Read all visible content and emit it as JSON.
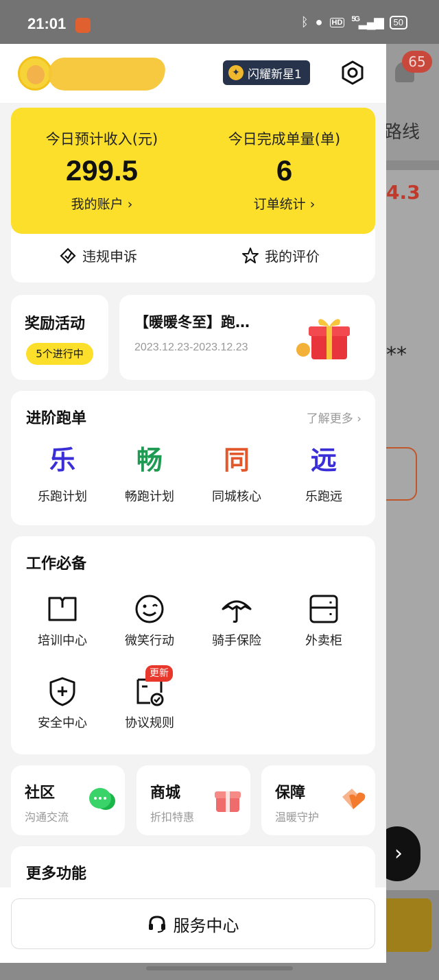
{
  "status_bar": {
    "time": "21:01",
    "network": "5G",
    "battery": "50",
    "hd": "HD"
  },
  "header": {
    "level_badge": "闪耀新星1"
  },
  "income_card": {
    "income_label": "今日预计收入(元)",
    "income_value": "299.5",
    "account_link": "我的账户 ›",
    "orders_label": "今日完成单量(单)",
    "orders_value": "6",
    "stats_link": "订单统计 ›",
    "appeal": "违规申诉",
    "rating": "我的评价"
  },
  "reward": {
    "title": "奖励活动",
    "count": "5个进行中"
  },
  "promo": {
    "title": "【暖暖冬至】跑…",
    "dates": "2023.12.23-2023.12.23"
  },
  "advanced": {
    "title": "进阶跑单",
    "more": "了解更多 ›",
    "items": [
      {
        "char": "乐",
        "label": "乐跑计划",
        "color": "#3a2fd6"
      },
      {
        "char": "畅",
        "label": "畅跑计划",
        "color": "#1e9a52"
      },
      {
        "char": "同",
        "label": "同城核心",
        "color": "#e3572c"
      },
      {
        "char": "远",
        "label": "乐跑远",
        "color": "#3a2fd6"
      }
    ]
  },
  "work": {
    "title": "工作必备",
    "items": [
      {
        "label": "培训中心",
        "icon": "book-icon"
      },
      {
        "label": "微笑行动",
        "icon": "smile-icon"
      },
      {
        "label": "骑手保险",
        "icon": "umbrella-icon"
      },
      {
        "label": "外卖柜",
        "icon": "locker-icon"
      },
      {
        "label": "安全中心",
        "icon": "shield-icon"
      },
      {
        "label": "协议规则",
        "icon": "agreement-icon"
      }
    ],
    "new_badge": "更新"
  },
  "mini_cards": [
    {
      "title": "社区",
      "sub": "沟通交流",
      "icon": "chat-icon"
    },
    {
      "title": "商城",
      "sub": "折扣特惠",
      "icon": "gift-box-icon"
    },
    {
      "title": "保障",
      "sub": "温暖守护",
      "icon": "heart-tag-icon"
    }
  ],
  "more_features": {
    "title": "更多功能"
  },
  "service": {
    "label": "服务中心"
  },
  "background": {
    "route": "路线",
    "rating": "4.3",
    "badge": "65",
    "stars": "**"
  },
  "colors": {
    "accent_yellow": "#fbdf2b",
    "badge_red": "#e8372b",
    "navy": "#26334b"
  }
}
